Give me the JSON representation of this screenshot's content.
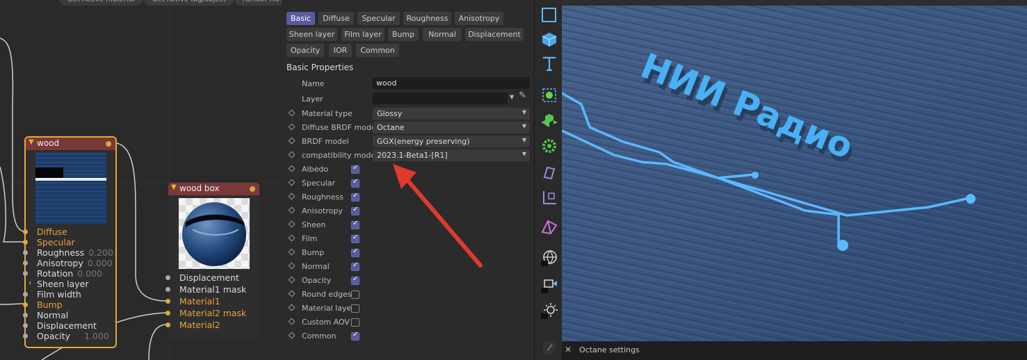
{
  "top_buttons": [
    "Get Active material",
    "Get Active tag/object",
    "Render AOVs"
  ],
  "nodes": {
    "wood": {
      "title": "wood",
      "ports": [
        {
          "label": "Diffuse",
          "value": ""
        },
        {
          "label": "Specular",
          "value": ""
        },
        {
          "label": "Roughness",
          "value": "0.200"
        },
        {
          "label": "Anisotropy",
          "value": "0.000"
        },
        {
          "label": "Rotation",
          "value": "0.000"
        },
        {
          "label": "Sheen layer",
          "value": ""
        },
        {
          "label": "Film width",
          "value": ""
        },
        {
          "label": "Bump",
          "value": ""
        },
        {
          "label": "Normal",
          "value": ""
        },
        {
          "label": "Displacement",
          "value": ""
        },
        {
          "label": "Opacity",
          "value": "1.000"
        }
      ]
    },
    "wood_box": {
      "title": "wood box",
      "ports": [
        {
          "label": "Displacement"
        },
        {
          "label": "Material1 mask"
        },
        {
          "label": "Material1"
        },
        {
          "label": "Material2 mask"
        },
        {
          "label": "Material2"
        }
      ]
    }
  },
  "tabs": [
    "Basic",
    "Diffuse",
    "Specular",
    "Roughness",
    "Anisotropy",
    "Sheen layer",
    "Film layer",
    "Bump",
    "Normal",
    "Displacement",
    "Opacity",
    "IOR",
    "Common"
  ],
  "active_tab": "Basic",
  "section_title": "Basic Properties",
  "properties": {
    "name": {
      "label": "Name",
      "value": "wood"
    },
    "layer": {
      "label": "Layer",
      "value": ""
    },
    "material_type": {
      "label": "Material type",
      "value": "Glossy"
    },
    "diffuse_brdf": {
      "label": "Diffuse BRDF model",
      "value": "Octane"
    },
    "brdf_model": {
      "label": "BRDF model",
      "value": "GGX(energy preserving)"
    },
    "compat_mode": {
      "label": "compatibility mode",
      "value": "2023.1-Beta1-[R1]"
    }
  },
  "checkboxes": [
    {
      "label": "Albedo",
      "checked": true
    },
    {
      "label": "Specular",
      "checked": true
    },
    {
      "label": "Roughness",
      "checked": true
    },
    {
      "label": "Anisotropy",
      "checked": true
    },
    {
      "label": "Sheen",
      "checked": true
    },
    {
      "label": "Film",
      "checked": true
    },
    {
      "label": "Bump",
      "checked": true
    },
    {
      "label": "Normal",
      "checked": true
    },
    {
      "label": "Opacity",
      "checked": true
    },
    {
      "label": "Round edges",
      "checked": false
    },
    {
      "label": "Material layer",
      "checked": false
    },
    {
      "label": "Custom AOV",
      "checked": false
    },
    {
      "label": "Common",
      "checked": true
    }
  ],
  "toolbar_icons": [
    "cube-outline-icon",
    "cube-icon",
    "text-icon",
    "null-object-icon",
    "cloner-icon",
    "gear-generator-icon",
    "deformer-icon",
    "axis-icon",
    "bend-icon",
    "octane-sky-icon",
    "octane-camera-icon",
    "octane-light-icon",
    "edit-icon"
  ],
  "viewport": {
    "render_text": "НИИ Радио",
    "octane_panel_title": "Octane settings"
  },
  "colors": {
    "accent": "#5a5aa0",
    "port_active": "#e8a23a",
    "node_header": "#7a3838",
    "neon": "#5ab8ff"
  }
}
